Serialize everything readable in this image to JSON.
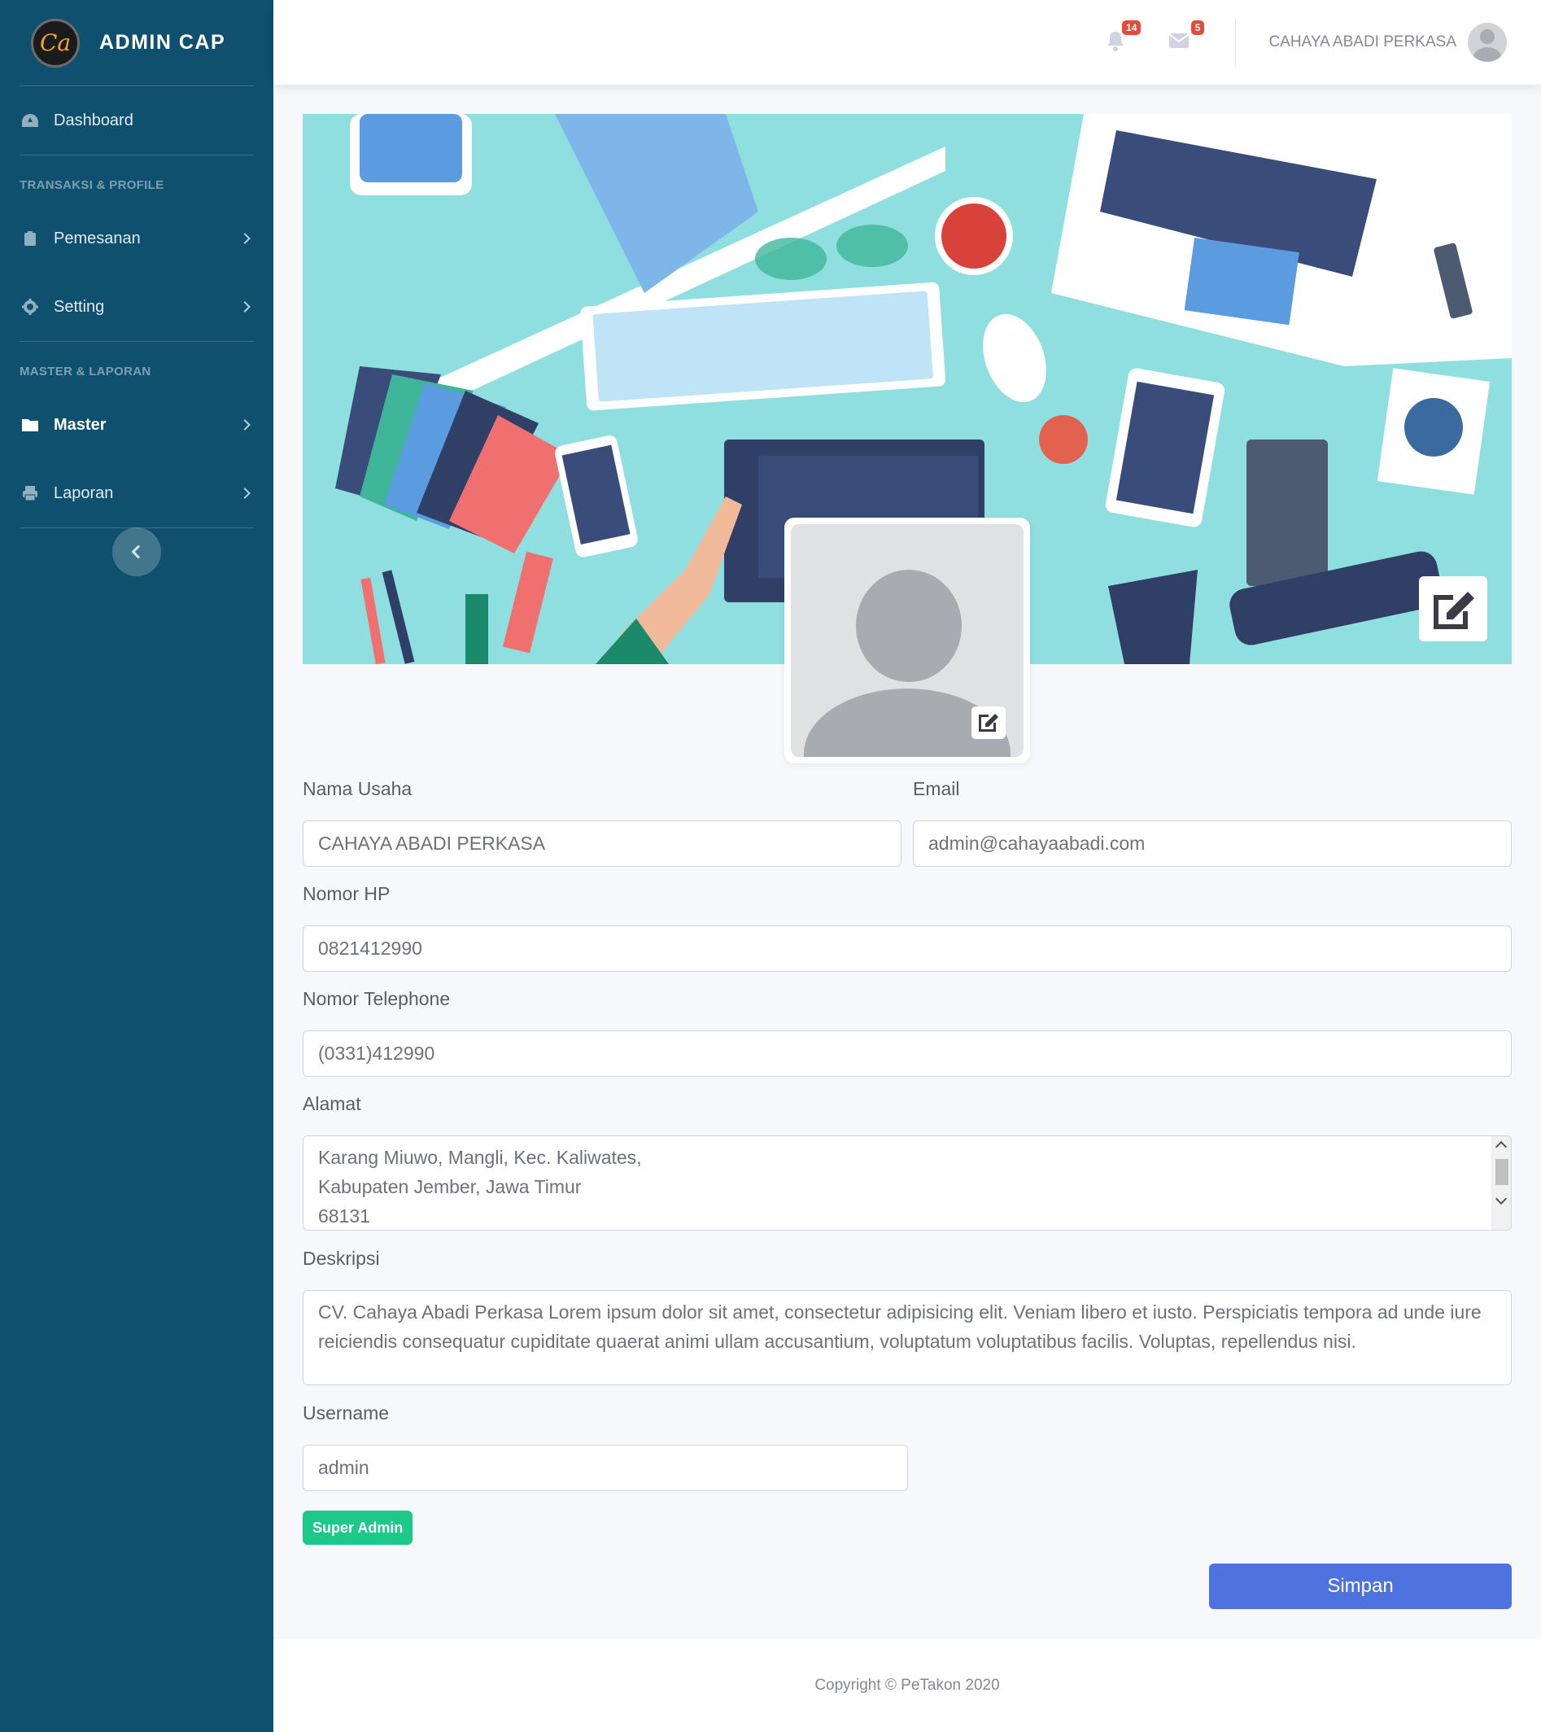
{
  "brand": {
    "name": "ADMIN CAP",
    "logo_text": "Ca"
  },
  "sidebar": {
    "dashboard": {
      "label": "Dashboard",
      "icon": "tachometer-icon"
    },
    "heading_1": "TRANSAKSI & PROFILE",
    "pemesanan": {
      "label": "Pemesanan",
      "icon": "clipboard-icon"
    },
    "setting": {
      "label": "Setting",
      "icon": "gear-icon"
    },
    "heading_2": "MASTER & LAPORAN",
    "master": {
      "label": "Master",
      "icon": "folder-icon"
    },
    "laporan": {
      "label": "Laporan",
      "icon": "printer-icon"
    }
  },
  "topbar": {
    "alerts_count": "14",
    "messages_count": "5",
    "user_name": "CAHAYA ABADI PERKASA"
  },
  "form": {
    "nama_usaha_label": "Nama Usaha",
    "nama_usaha_value": "CAHAYA ABADI PERKASA",
    "email_label": "Email",
    "email_value": "admin@cahayaabadi.com",
    "nomor_hp_label": "Nomor HP",
    "nomor_hp_value": "0821412990",
    "nomor_telephone_label": "Nomor Telephone",
    "nomor_telephone_value": "(0331)412990",
    "alamat_label": "Alamat",
    "alamat_line_1": "Karang Miuwo, Mangli, Kec. Kaliwates,",
    "alamat_line_2": "Kabupaten Jember, Jawa Timur",
    "alamat_line_3": "68131",
    "deskripsi_label": "Deskripsi",
    "deskripsi_value": "CV. Cahaya Abadi Perkasa Lorem ipsum dolor sit amet, consectetur adipisicing elit. Veniam libero et iusto. Perspiciatis tempora ad unde iure reiciendis consequatur cupiditate quaerat animi ullam accusantium, voluptatum voluptatibus facilis. Voluptas, repellendus nisi.",
    "username_label": "Username",
    "username_value": "admin",
    "role_badge": "Super Admin",
    "save_button": "Simpan"
  },
  "footer": {
    "copyright": "Copyright © PeTakon 2020"
  },
  "colors": {
    "sidebar_bg": "#0e506e",
    "primary": "#4e73df",
    "success": "#1cc88a",
    "danger": "#e74a3b",
    "banner_bg": "#8fdfe0"
  }
}
